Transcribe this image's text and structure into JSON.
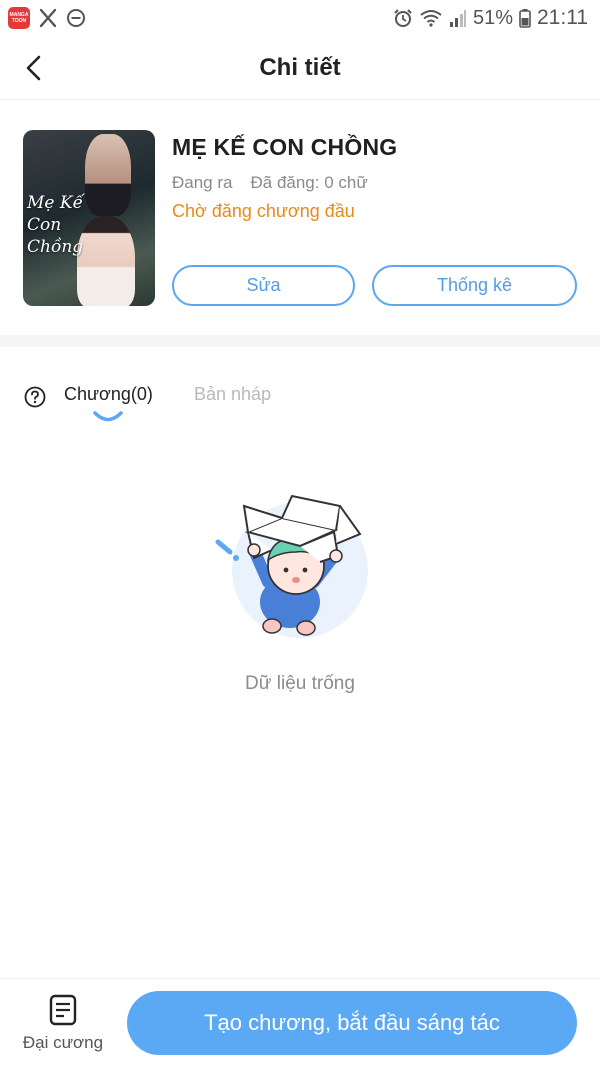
{
  "status_bar": {
    "app_badge": "MANGA TOON",
    "battery": "51%",
    "time": "21:11"
  },
  "header": {
    "title": "Chi tiết"
  },
  "book": {
    "cover_text": "Mẹ Kế\nCon\nChồng",
    "title": "MẸ KẾ CON CHỒNG",
    "status": "Đang ra",
    "word_count": "Đã đăng: 0 chữ",
    "chapter_status": "Chờ đăng chương đầu",
    "edit_label": "Sửa",
    "stats_label": "Thống kê"
  },
  "tabs": {
    "chapters_label": "Chương(0)",
    "drafts_label": "Bản nháp"
  },
  "empty": {
    "message": "Dữ liệu trống"
  },
  "bottom": {
    "outline_label": "Đại cương",
    "create_label": "Tạo chương, bắt đầu sáng tác"
  },
  "colors": {
    "accent": "#5ba8f4",
    "orange": "#e8891b"
  }
}
